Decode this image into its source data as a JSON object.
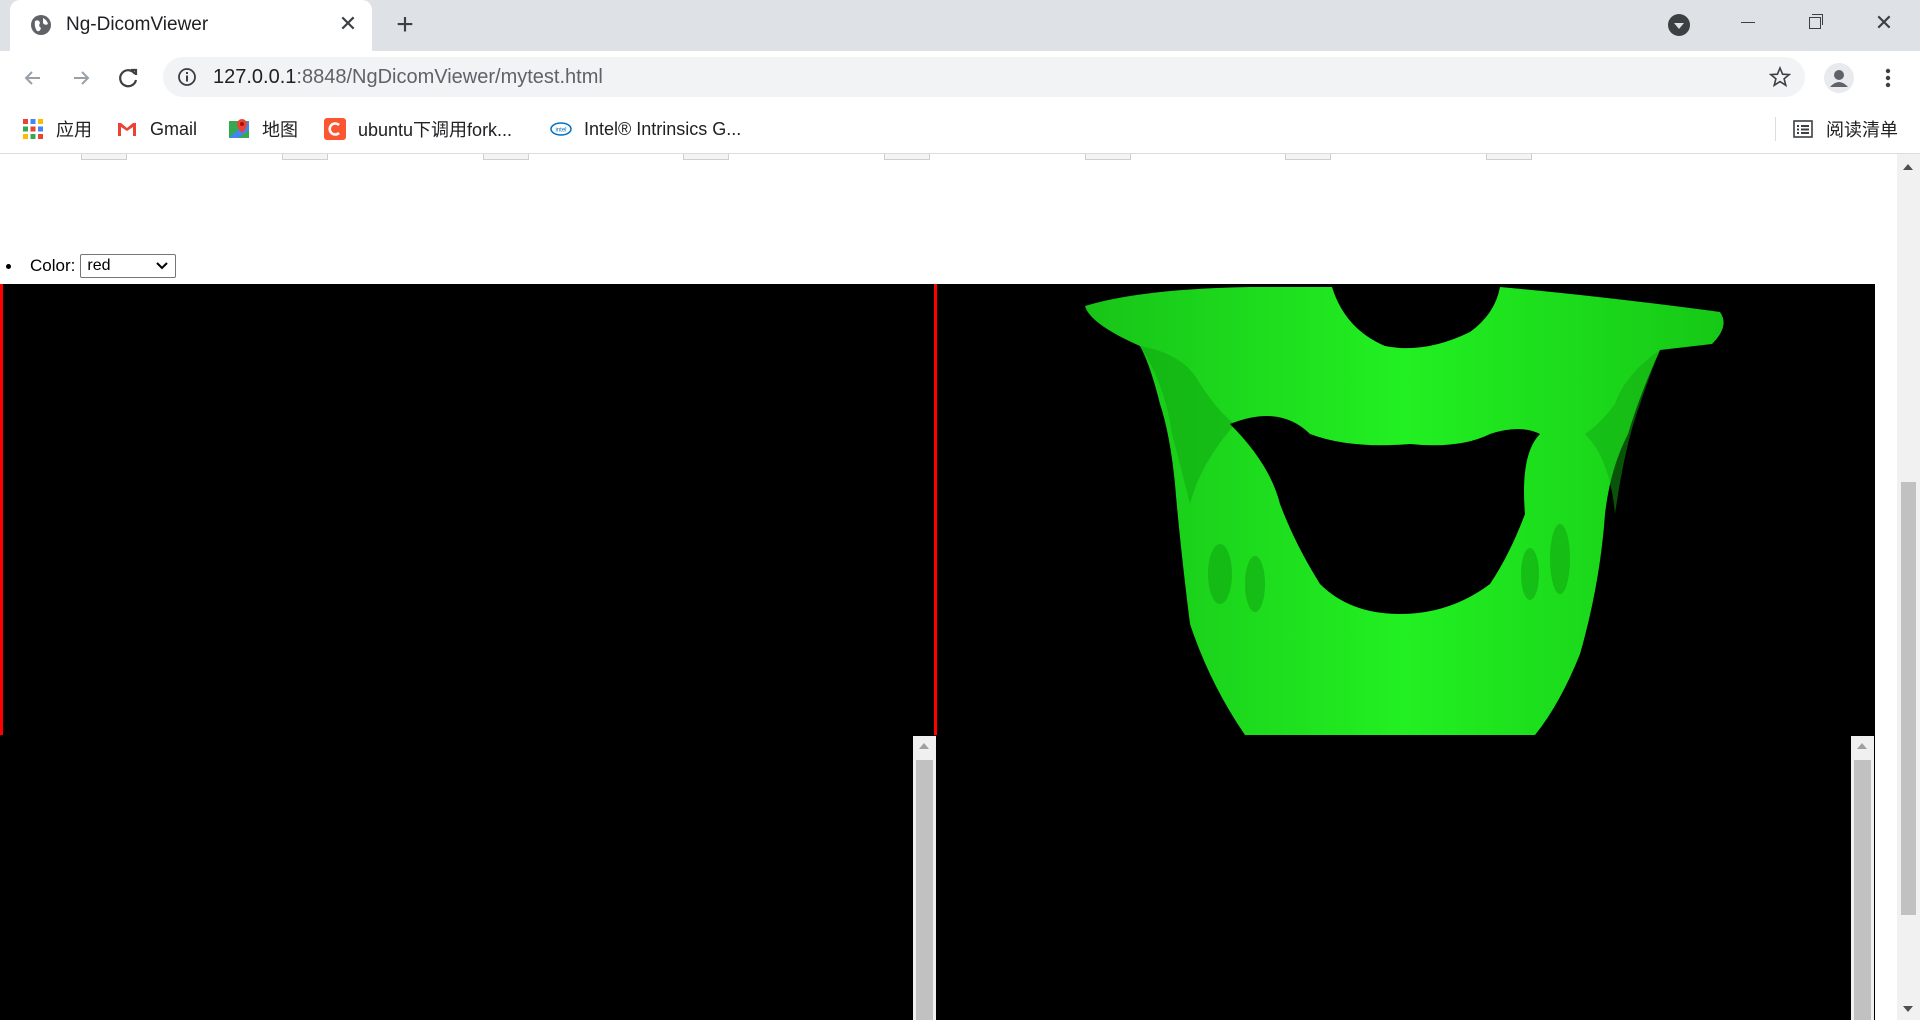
{
  "tab": {
    "title": "Ng-DicomViewer"
  },
  "address_bar": {
    "url_host": "127.0.0.1",
    "url_rest": ":8848/NgDicomViewer/mytest.html"
  },
  "bookmarks": {
    "items": [
      {
        "label": "应用",
        "icon": "apps-grid-icon"
      },
      {
        "label": "Gmail",
        "icon": "gmail-icon"
      },
      {
        "label": "地图",
        "icon": "maps-icon"
      },
      {
        "label": "ubuntu下调用fork...",
        "icon": "csdn-icon"
      },
      {
        "label": "Intel® Intrinsics G...",
        "icon": "intel-icon"
      }
    ],
    "reading_list": "阅读清单"
  },
  "page": {
    "color_label": "Color:",
    "color_value": "red",
    "color_options": [
      "red"
    ],
    "viewport_bg": "#000000",
    "crosshair_color": "#ff0000",
    "model_color": "#1ee61e"
  }
}
